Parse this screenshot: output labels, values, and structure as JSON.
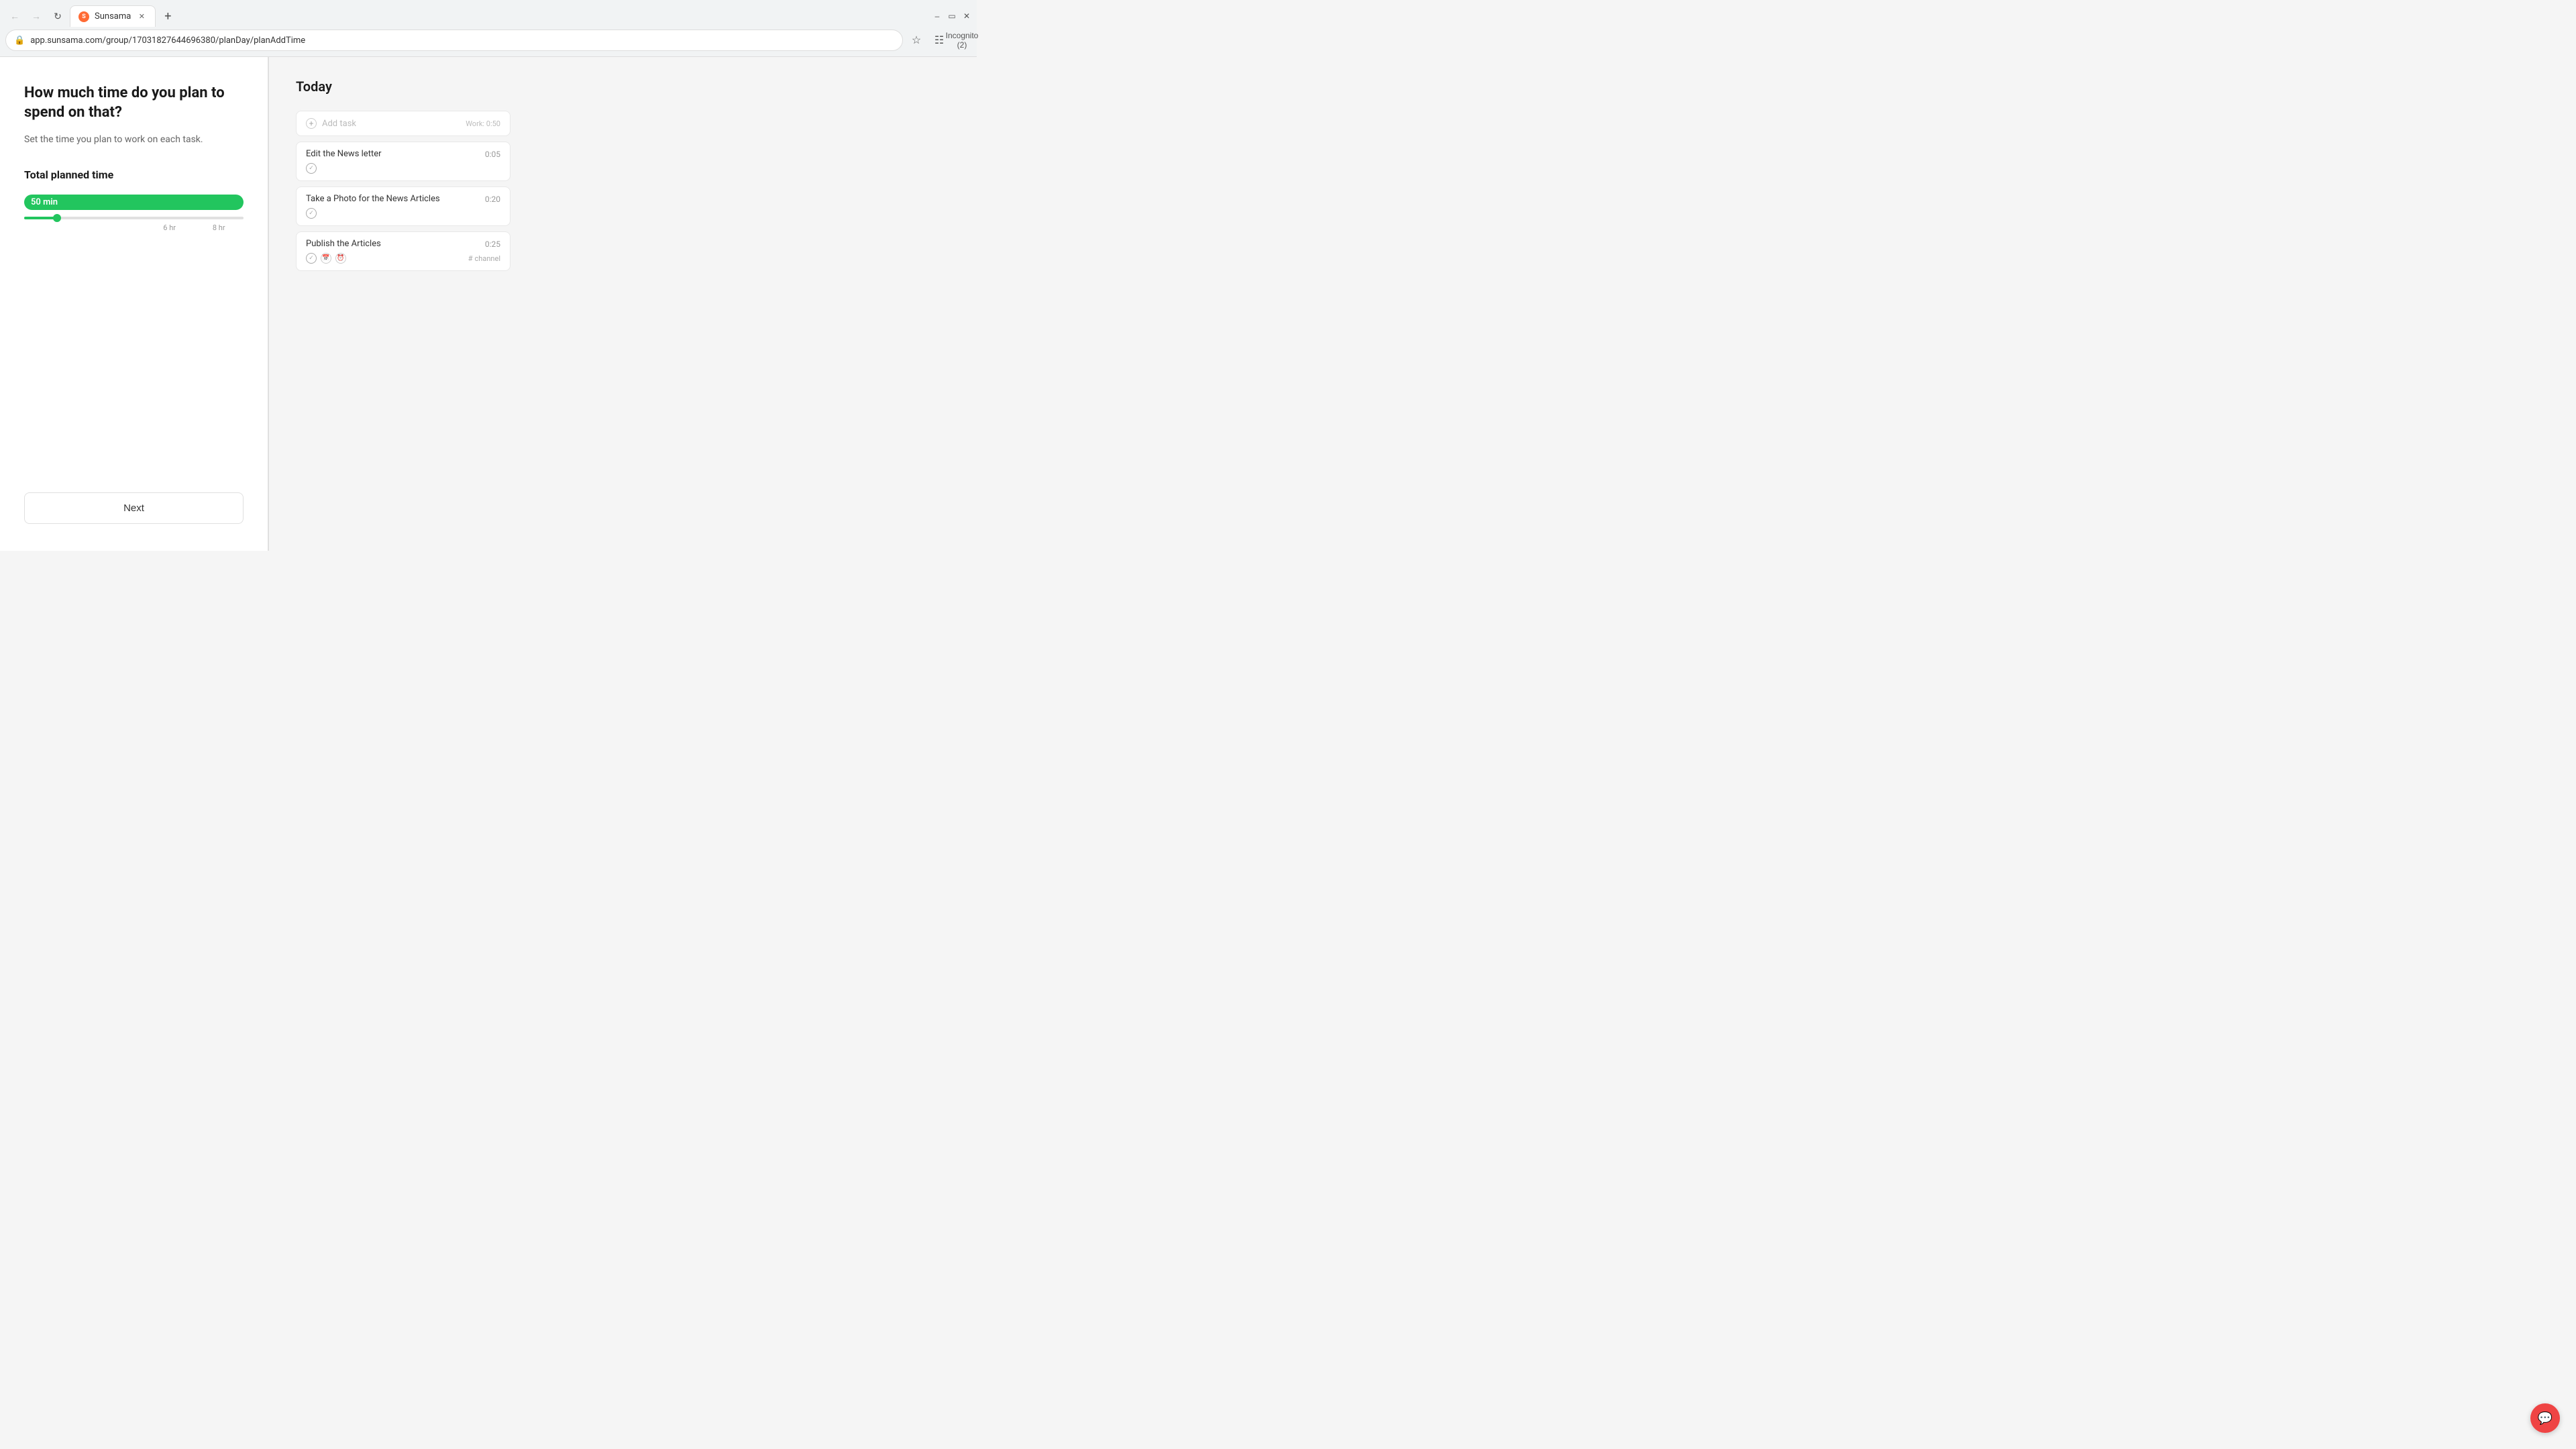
{
  "browser": {
    "tab_label": "Sunsama",
    "tab_favicon_text": "S",
    "url": "app.sunsama.com/group/17031827644696380/planDay/planAddTime",
    "incognito_label": "Incognito (2)"
  },
  "left_panel": {
    "heading": "How much time do you plan to spend on that?",
    "subheading": "Set the time you plan to work on each task.",
    "total_time_label": "Total planned time",
    "time_badge": "50 min",
    "slider_fill_pct": "15%",
    "slider_label_1": "6 hr",
    "slider_label_2": "8 hr",
    "next_button_label": "Next"
  },
  "right_panel": {
    "heading": "Today",
    "tasks": [
      {
        "id": "add-task",
        "name": "Add task",
        "time": "Work: 0:50",
        "type": "add"
      },
      {
        "id": "edit-news-letter",
        "name": "Edit the News letter",
        "time": "0:05",
        "has_check": true
      },
      {
        "id": "take-photo",
        "name": "Take a Photo for the News Articles",
        "time": "0:20",
        "has_check": true
      },
      {
        "id": "publish-articles",
        "name": "Publish the Articles",
        "time": "0:25",
        "has_check": true,
        "has_calendar": true,
        "has_clock": true,
        "channel": "channel"
      }
    ]
  },
  "chat": {
    "icon": "💬"
  }
}
